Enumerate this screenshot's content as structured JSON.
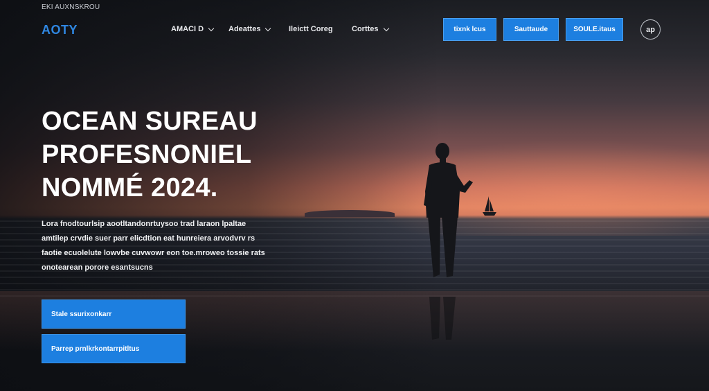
{
  "header": {
    "caption": "EKI AUXNSKROU",
    "logo": "AOTY",
    "nav": [
      {
        "label": "AMACI D",
        "has_dropdown": true
      },
      {
        "label": "Adeattes",
        "has_dropdown": true
      },
      {
        "label": "Ileictt Coreg",
        "has_dropdown": false
      },
      {
        "label": "Corttes",
        "has_dropdown": true
      }
    ],
    "buttons": [
      "tixnk lcus",
      "Sauttaude",
      "SOULE.itaus"
    ],
    "avatar": "ap"
  },
  "hero": {
    "headline_lines": [
      "OCEAN SUREAU",
      "PROFESNONIEL",
      "NOMMÉ 2024."
    ],
    "body_lines": [
      "Lora fnodtourlsip aootltandonrtuysoo trad laraon lpaltae",
      "amtilep crvdie suer parr elicdtion eat hunreiera arvodvrv rs",
      "faotie ecuolelute lowvbe cuvwowr eon toe.mroweo tossie rats",
      "onotearean porore esantsucns"
    ],
    "cta_primary": "Stale ssurixonkarr",
    "cta_secondary": "Parrep prnlkrkontarrpitltus"
  },
  "colors": {
    "accent": "#1d7fe0",
    "logo": "#2f86e0"
  },
  "icons": [
    "chevron-down-icon",
    "person-silhouette",
    "sailboat"
  ]
}
